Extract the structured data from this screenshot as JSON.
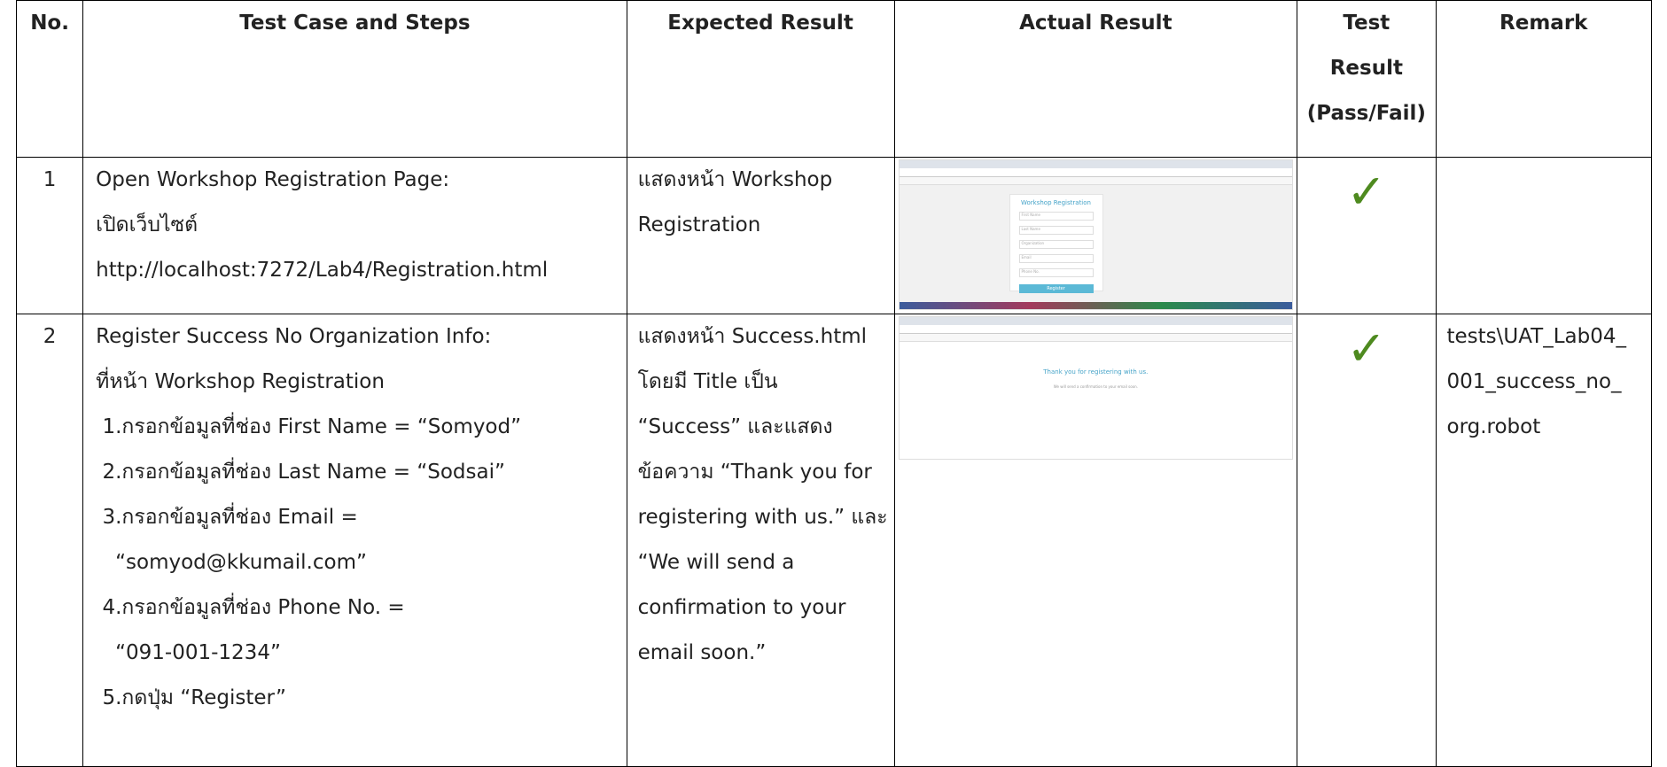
{
  "headers": {
    "no": "No.",
    "test_case": "Test Case and Steps",
    "expected": "Expected Result",
    "actual": "Actual Result",
    "test_result": [
      "Test",
      "Result",
      "(Pass/Fail)"
    ],
    "remark": "Remark"
  },
  "rows": [
    {
      "no": "1",
      "steps": [
        "Open Workshop Registration Page:",
        "เปิดเว็บไซต์",
        "http://localhost:7272/Lab4/Registration.html"
      ],
      "expected": [
        "แสดงหน้า Workshop",
        "Registration"
      ],
      "actual_screenshot": {
        "card_title": "Workshop Registration",
        "fields": [
          "First Name",
          "Last Name",
          "Organization",
          "Email",
          "Phone No."
        ],
        "button": "Register"
      },
      "result_icon": "check-mark-icon",
      "result_symbol": "✓",
      "remark": []
    },
    {
      "no": "2",
      "steps": [
        "Register Success No Organization Info:",
        "ที่หน้า Workshop Registration",
        " 1.กรอกข้อมูลที่ช่อง First Name = “Somyod”",
        " 2.กรอกข้อมูลที่ช่อง Last Name = “Sodsai”",
        " 3.กรอกข้อมูลที่ช่อง Email =",
        "   “somyod@kkumail.com”",
        " 4.กรอกข้อมูลที่ช่อง Phone No. =",
        "   “091-001-1234”",
        " 5.กดปุ่ม “Register”"
      ],
      "expected": [
        "แสดงหน้า Success.html",
        "โดยมี Title เป็น",
        "“Success” และแสดง",
        "ข้อความ “Thank you for",
        "registering with us.” และ",
        "“We will send a",
        "confirmation to your",
        "email soon.”"
      ],
      "actual_screenshot": {
        "message": "Thank you for registering with us.",
        "sub_message": "We will send a confirmation to your email soon."
      },
      "result_icon": "check-mark-icon",
      "result_symbol": "✓",
      "remark": [
        "tests\\UAT_Lab04_",
        "001_success_no_",
        "org.robot"
      ]
    }
  ],
  "colors": {
    "check": "#4e8a1f",
    "accent": "#45a3c8",
    "button": "#5bb9d6"
  }
}
